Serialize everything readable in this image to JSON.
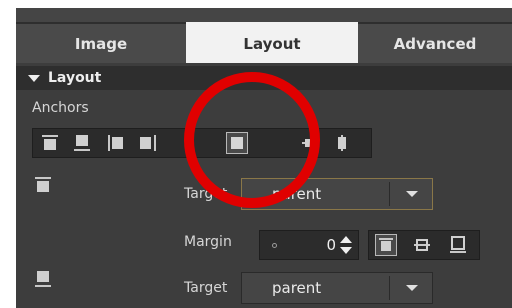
{
  "tabs": [
    {
      "label": "Image",
      "active": false
    },
    {
      "label": "Layout",
      "active": true
    },
    {
      "label": "Advanced",
      "active": false
    }
  ],
  "section": {
    "title": "Layout",
    "expanded": true
  },
  "anchors": {
    "label": "Anchors",
    "buttons": [
      {
        "name": "top-anchor",
        "selected": false
      },
      {
        "name": "bottom-anchor",
        "selected": false
      },
      {
        "name": "left-anchor",
        "selected": false
      },
      {
        "name": "right-anchor",
        "selected": false
      },
      {
        "name": "fill-parent-anchor",
        "selected": true
      },
      {
        "name": "vertical-center-anchor",
        "selected": false
      },
      {
        "name": "horizontal-center-anchor",
        "selected": false
      }
    ]
  },
  "top_anchor": {
    "target_label": "Target",
    "target_value": "parent",
    "margin_label": "Margin",
    "margin_value": "0",
    "margin_alignment": [
      "top",
      "center",
      "bottom"
    ]
  },
  "bottom_anchor": {
    "target_label": "Target",
    "target_value": "parent"
  },
  "colors": {
    "panel_bg": "#3d3d3d",
    "active_tab": "#f2f2f2",
    "highlight_ring": "#e00000",
    "focus_border": "#8a7748"
  }
}
